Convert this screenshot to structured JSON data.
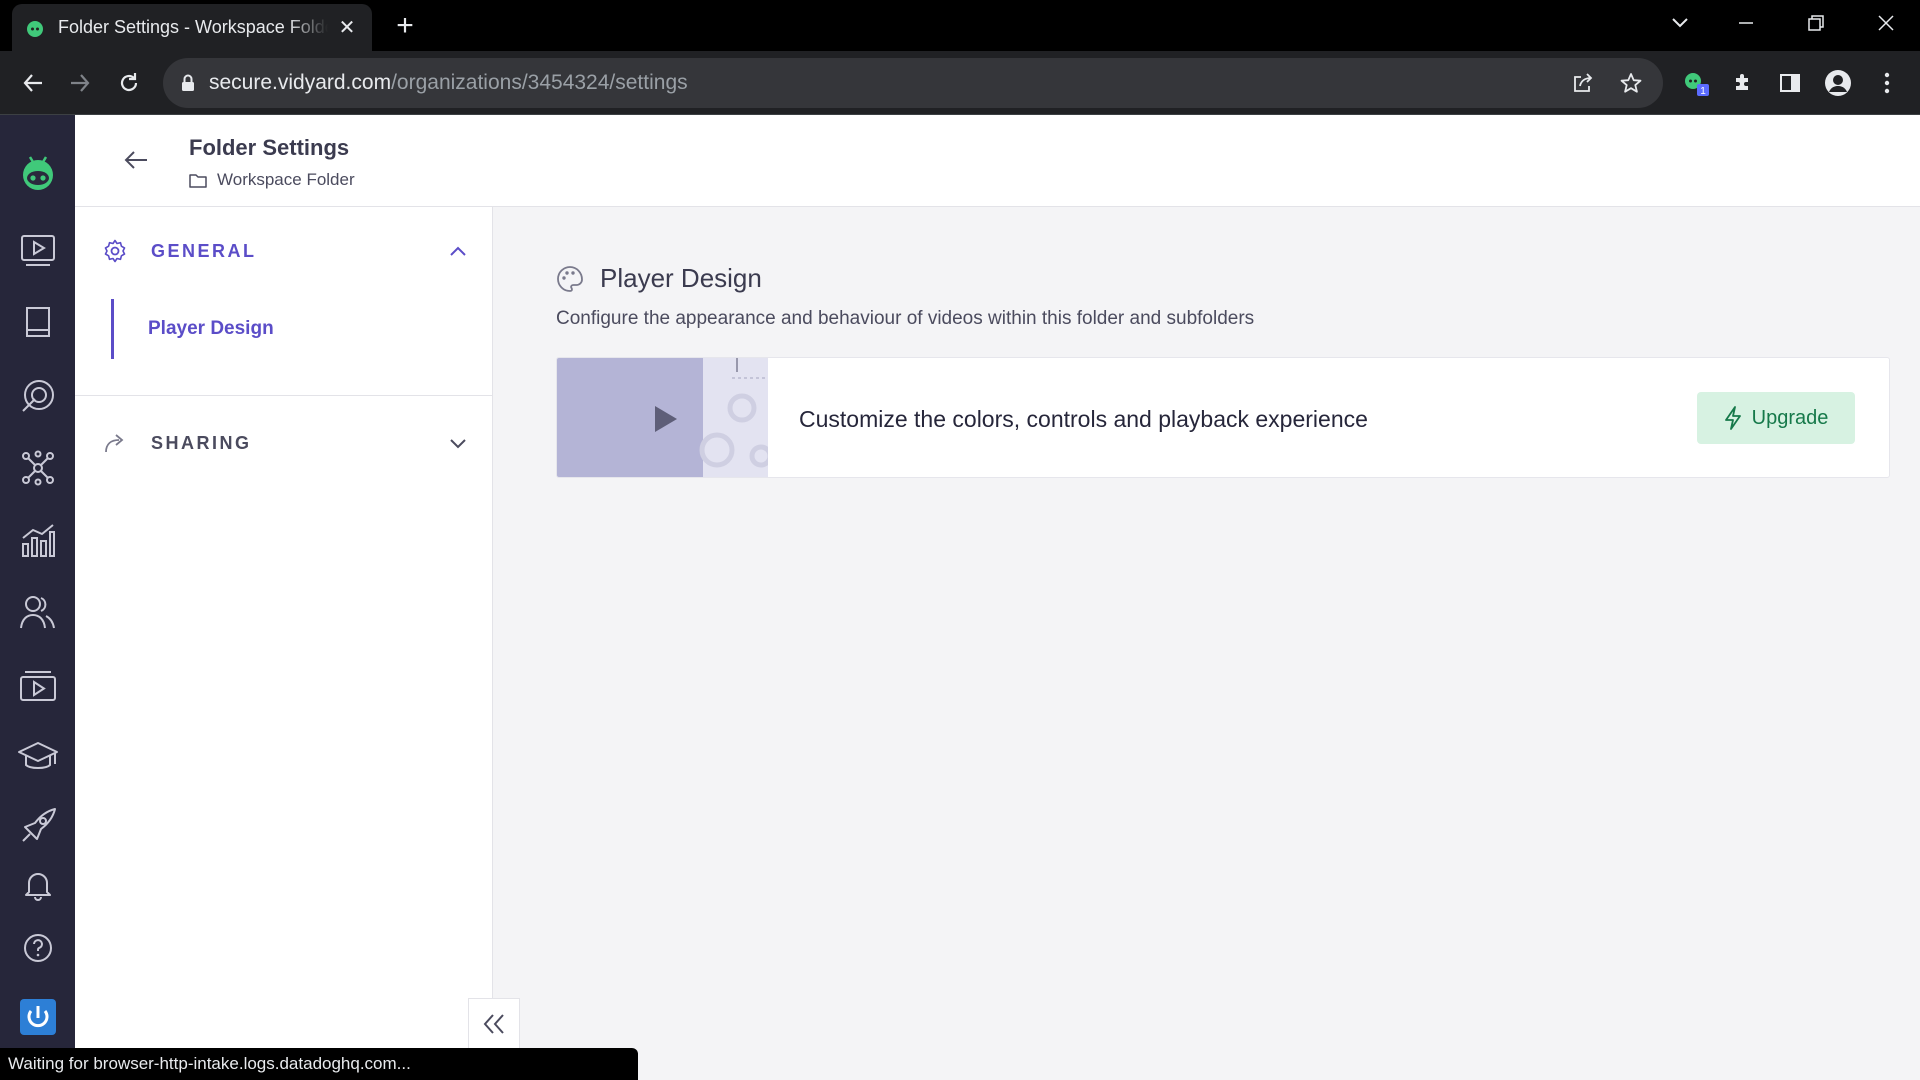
{
  "browser": {
    "tab_title": "Folder Settings - Workspace Folder",
    "url_host": "secure.vidyard.com",
    "url_path": "/organizations/3454324/settings",
    "extension_badge": "1",
    "status_text": "Waiting for browser-http-intake.logs.datadoghq.com..."
  },
  "header": {
    "title": "Folder Settings",
    "breadcrumb": "Workspace Folder"
  },
  "settings_nav": {
    "general_label": "GENERAL",
    "general_items": [
      "Player Design"
    ],
    "sharing_label": "SHARING"
  },
  "main": {
    "section_title": "Player Design",
    "section_description": "Configure the appearance and behaviour of videos within this folder and subfolders",
    "upsell_text": "Customize the colors, controls and playback experience",
    "upgrade_label": "Upgrade"
  },
  "rail": {
    "items": [
      "vidyard-logo-icon",
      "videos-icon",
      "library-icon",
      "insights-icon",
      "integrations-icon",
      "analytics-icon",
      "contacts-icon",
      "channels-icon",
      "learn-icon",
      "launch-icon",
      "notifications-icon",
      "help-icon",
      "account-power-icon"
    ]
  },
  "colors": {
    "accent": "#5b4dc8",
    "rail_bg": "#26263a",
    "upgrade_bg": "#d7f2e2",
    "upgrade_text": "#16794a",
    "brand_green": "#40c97a"
  }
}
